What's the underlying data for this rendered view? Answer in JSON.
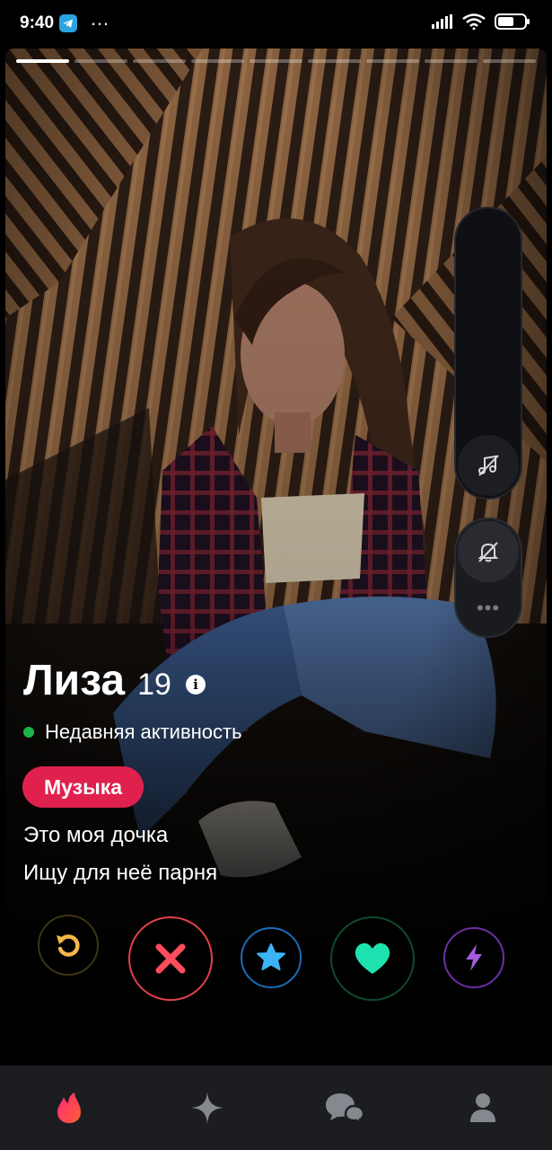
{
  "status_bar": {
    "time": "9:40",
    "icons": [
      "telegram-icon",
      "signal-icon",
      "wifi-icon",
      "battery-icon"
    ]
  },
  "profile": {
    "name": "Лиза",
    "age": "19",
    "activity": "Недавняя активность",
    "tag": "Музыка",
    "bio_lines": [
      "Это моя дочка",
      "Ищу для неё парня"
    ],
    "photo_count": 9,
    "active_photo": 0
  },
  "side_controls": {
    "music_icon": "music-off-icon",
    "mute_icon": "bell-off-icon",
    "more": "•••"
  },
  "actions": [
    "rewind",
    "nope",
    "super-like",
    "like",
    "boost"
  ],
  "colors": {
    "accent": "#e0214d",
    "rewind": "#f5b748",
    "nope": "#fd4c5c",
    "super_like": "#3ab4f5",
    "like": "#1ee3b1",
    "boost": "#a55dde",
    "activity_dot": "#1cb34b"
  },
  "nav": [
    "flame-icon",
    "sparkle-icon",
    "chat-icon",
    "profile-icon"
  ]
}
